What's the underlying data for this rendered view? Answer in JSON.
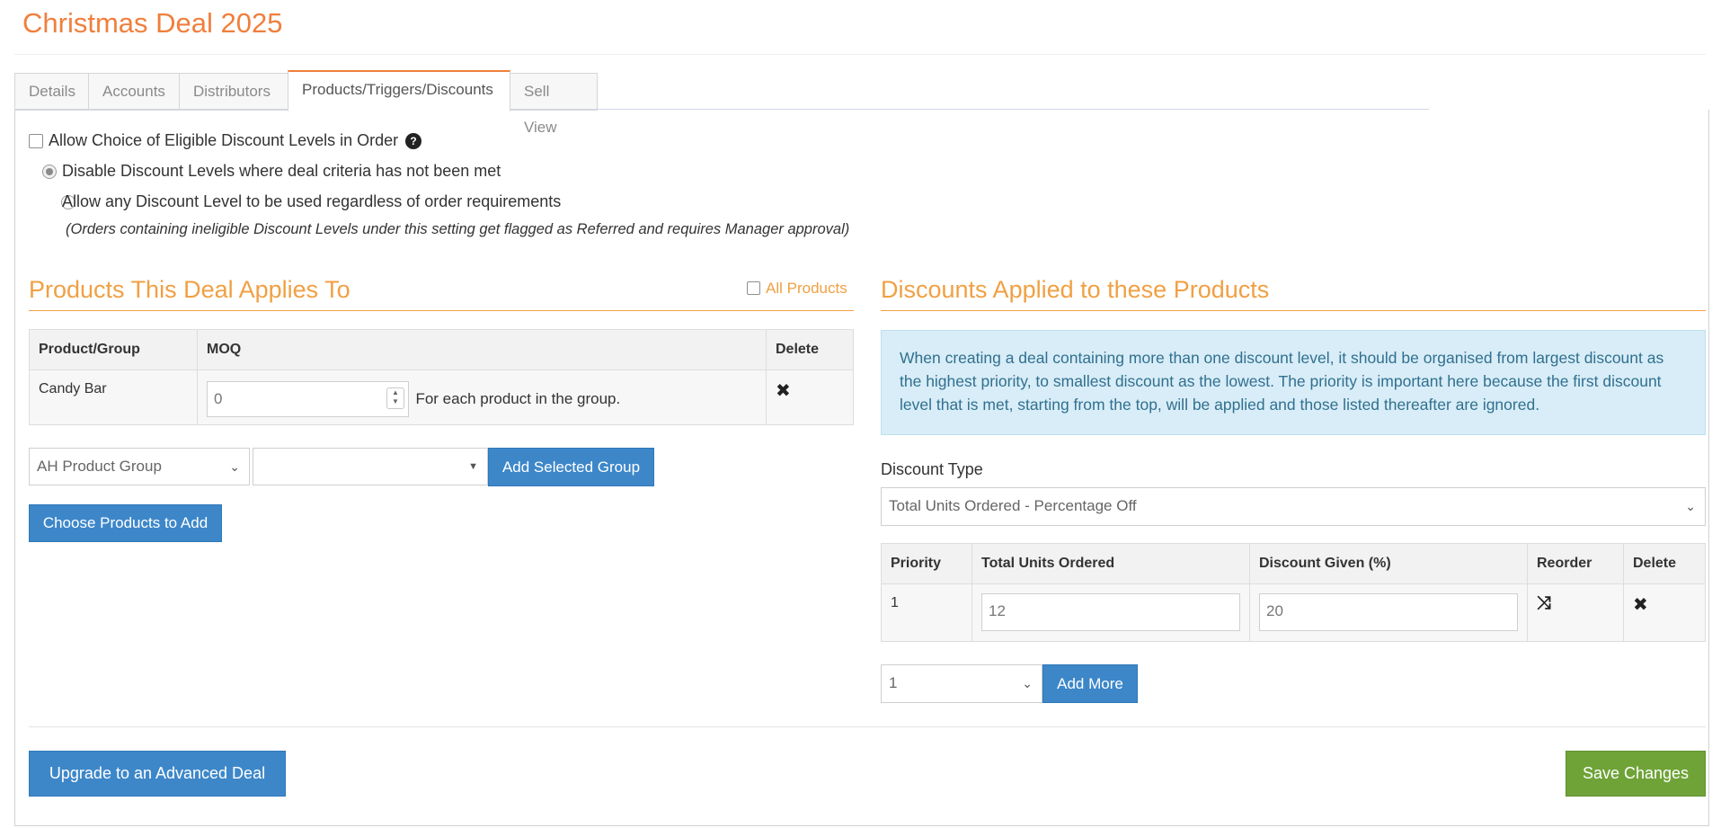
{
  "page": {
    "title": "Christmas Deal 2025"
  },
  "tabs": [
    {
      "label": "Details"
    },
    {
      "label": "Accounts"
    },
    {
      "label": "Distributors"
    },
    {
      "label": "Products/Triggers/Discounts",
      "active": true
    },
    {
      "label": "Sell View"
    }
  ],
  "options": {
    "allow_choice_label": "Allow Choice of Eligible Discount Levels in Order",
    "allow_choice_checked": false,
    "radio_disable_label": "Disable Discount Levels where deal criteria has not been met",
    "radio_disable_selected": true,
    "radio_allow_label": "Allow any Discount Level to be used regardless of order requirements",
    "radio_allow_selected": false,
    "note": "(Orders containing ineligible Discount Levels under this setting get flagged as Referred and requires Manager approval)"
  },
  "products": {
    "title": "Products This Deal Applies To",
    "all_products_label": "All Products",
    "all_products_checked": false,
    "columns": [
      "Product/Group",
      "MOQ",
      "Delete"
    ],
    "rows": [
      {
        "product": "Candy Bar",
        "moq": "0",
        "moq_suffix": "For each product in the group."
      }
    ],
    "group_select_value": "AH Product Group",
    "group_item_select_value": "",
    "add_group_button": "Add Selected Group",
    "choose_products_button": "Choose Products to Add"
  },
  "discounts": {
    "title": "Discounts Applied to these Products",
    "info": "When creating a deal containing more than one discount level, it should be organised from largest discount as the highest priority, to smallest discount as the lowest. The priority is important here because the first discount level that is met, starting from the top, will be applied and those listed thereafter are ignored.",
    "type_label": "Discount Type",
    "type_value": "Total Units Ordered - Percentage Off",
    "columns": [
      "Priority",
      "Total Units Ordered",
      "Discount Given (%)",
      "Reorder",
      "Delete"
    ],
    "rows": [
      {
        "priority": "1",
        "total_units": "12",
        "discount": "20"
      }
    ],
    "add_count_value": "1",
    "add_more_button": "Add More"
  },
  "footer": {
    "upgrade_button": "Upgrade to an Advanced Deal",
    "save_button": "Save Changes"
  },
  "colors": {
    "accent_orange": "#f07f3c",
    "section_orange": "#f0a044",
    "primary_blue": "#3d87c9",
    "save_green": "#6fa338",
    "info_bg": "#d8edf7"
  }
}
